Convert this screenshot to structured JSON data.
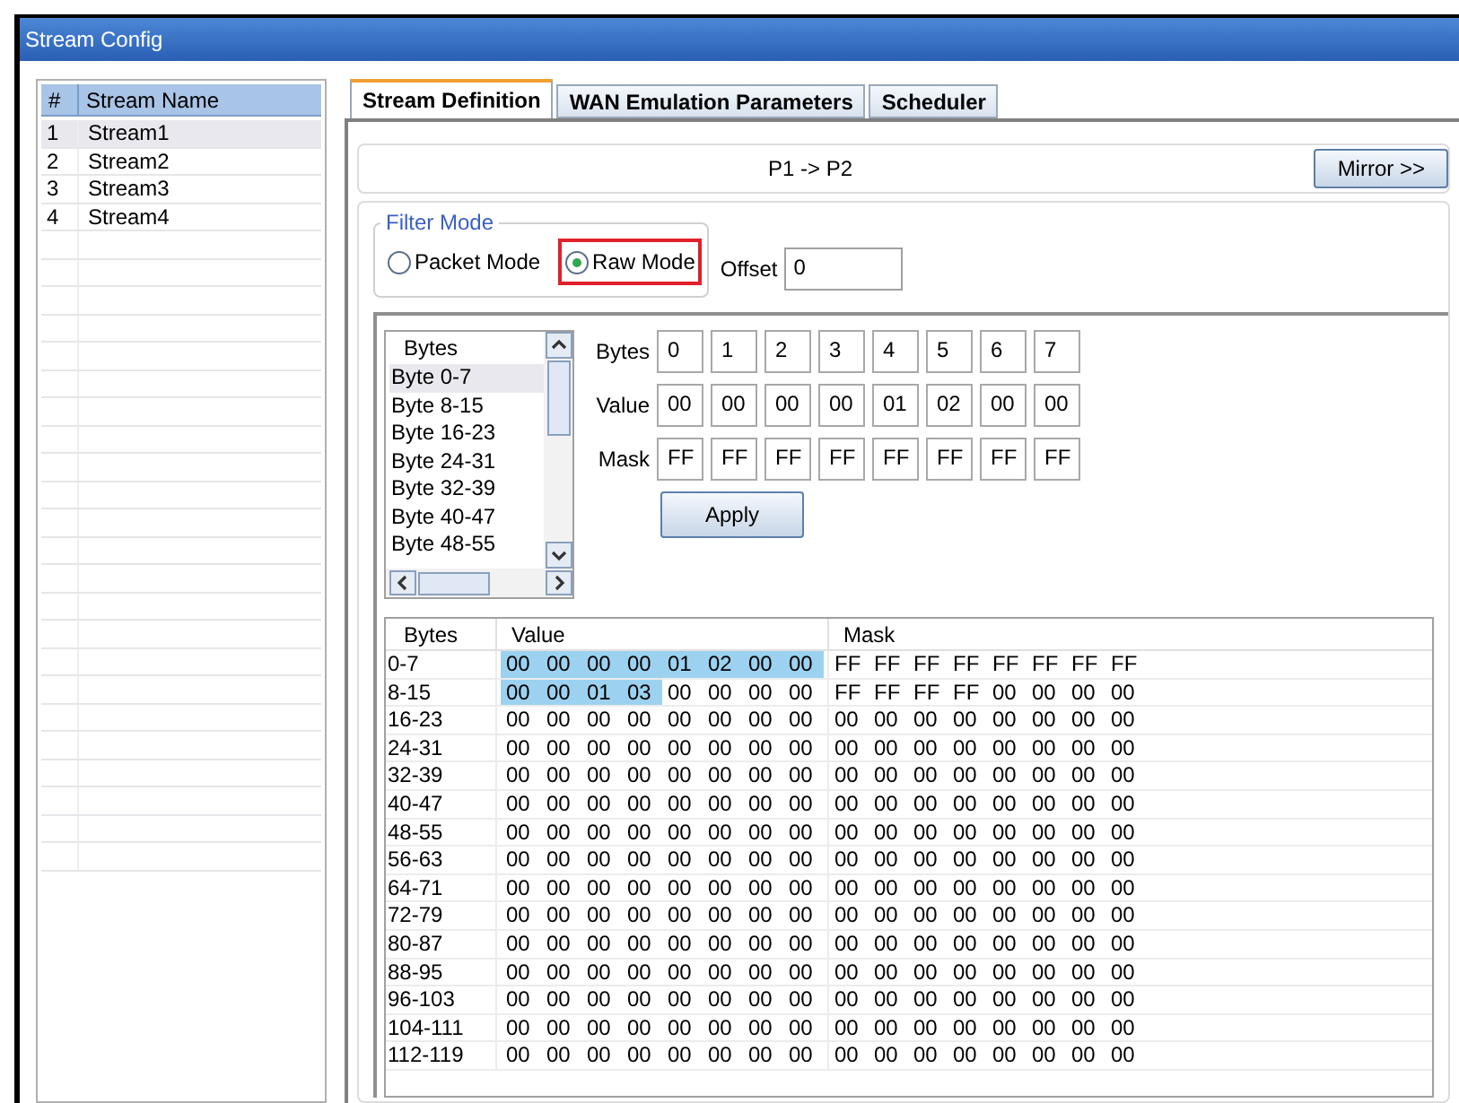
{
  "window": {
    "title": "Stream Config"
  },
  "streams": {
    "columns": [
      "#",
      "Stream Name"
    ],
    "rows": [
      {
        "num": "1",
        "name": "Stream1",
        "selected": true
      },
      {
        "num": "2",
        "name": "Stream2",
        "selected": false
      },
      {
        "num": "3",
        "name": "Stream3",
        "selected": false
      },
      {
        "num": "4",
        "name": "Stream4",
        "selected": false
      }
    ]
  },
  "tabs": [
    {
      "label": "Stream Definition",
      "selected": true
    },
    {
      "label": "WAN Emulation Parameters",
      "selected": false
    },
    {
      "label": "Scheduler",
      "selected": false
    }
  ],
  "direction": "P1 -> P2",
  "mirror_button": "Mirror >>",
  "filter_mode": {
    "legend": "Filter Mode",
    "options": [
      {
        "label": "Packet Mode",
        "selected": false
      },
      {
        "label": "Raw Mode",
        "selected": true
      }
    ]
  },
  "offset": {
    "label": "Offset",
    "value": "0"
  },
  "byte_list": {
    "header": "Bytes",
    "items": [
      {
        "label": "Byte 0-7",
        "selected": true
      },
      {
        "label": "Byte 8-15",
        "selected": false
      },
      {
        "label": "Byte 16-23",
        "selected": false
      },
      {
        "label": "Byte 24-31",
        "selected": false
      },
      {
        "label": "Byte 32-39",
        "selected": false
      },
      {
        "label": "Byte 40-47",
        "selected": false
      },
      {
        "label": "Byte 48-55",
        "selected": false
      }
    ]
  },
  "editor": {
    "bytes_label": "Bytes",
    "bytes": [
      "0",
      "1",
      "2",
      "3",
      "4",
      "5",
      "6",
      "7"
    ],
    "value_label": "Value",
    "values": [
      "00",
      "00",
      "00",
      "00",
      "01",
      "02",
      "00",
      "00"
    ],
    "mask_label": "Mask",
    "masks": [
      "FF",
      "FF",
      "FF",
      "FF",
      "FF",
      "FF",
      "FF",
      "FF"
    ],
    "apply_button": "Apply"
  },
  "table": {
    "columns": [
      "Bytes",
      "Value",
      "Mask"
    ],
    "rows": [
      {
        "bytes": "0-7",
        "values": [
          {
            "v": "00",
            "selected": true
          },
          {
            "v": "00",
            "selected": true
          },
          {
            "v": "00",
            "selected": true
          },
          {
            "v": "00",
            "selected": true
          },
          {
            "v": "01",
            "selected": true
          },
          {
            "v": "02",
            "selected": true
          },
          {
            "v": "00",
            "selected": true
          },
          {
            "v": "00",
            "selected": true
          }
        ],
        "masks": [
          "FF",
          "FF",
          "FF",
          "FF",
          "FF",
          "FF",
          "FF",
          "FF"
        ]
      },
      {
        "bytes": "8-15",
        "values": [
          {
            "v": "00",
            "selected": true
          },
          {
            "v": "00",
            "selected": true
          },
          {
            "v": "01",
            "selected": true
          },
          {
            "v": "03",
            "selected": true
          },
          {
            "v": "00",
            "selected": false
          },
          {
            "v": "00",
            "selected": false
          },
          {
            "v": "00",
            "selected": false
          },
          {
            "v": "00",
            "selected": false
          }
        ],
        "masks": [
          "FF",
          "FF",
          "FF",
          "FF",
          "00",
          "00",
          "00",
          "00"
        ]
      },
      {
        "bytes": "16-23",
        "values": [
          {
            "v": "00",
            "selected": false
          },
          {
            "v": "00",
            "selected": false
          },
          {
            "v": "00",
            "selected": false
          },
          {
            "v": "00",
            "selected": false
          },
          {
            "v": "00",
            "selected": false
          },
          {
            "v": "00",
            "selected": false
          },
          {
            "v": "00",
            "selected": false
          },
          {
            "v": "00",
            "selected": false
          }
        ],
        "masks": [
          "00",
          "00",
          "00",
          "00",
          "00",
          "00",
          "00",
          "00"
        ]
      },
      {
        "bytes": "24-31",
        "values": [
          {
            "v": "00",
            "selected": false
          },
          {
            "v": "00",
            "selected": false
          },
          {
            "v": "00",
            "selected": false
          },
          {
            "v": "00",
            "selected": false
          },
          {
            "v": "00",
            "selected": false
          },
          {
            "v": "00",
            "selected": false
          },
          {
            "v": "00",
            "selected": false
          },
          {
            "v": "00",
            "selected": false
          }
        ],
        "masks": [
          "00",
          "00",
          "00",
          "00",
          "00",
          "00",
          "00",
          "00"
        ]
      },
      {
        "bytes": "32-39",
        "values": [
          {
            "v": "00",
            "selected": false
          },
          {
            "v": "00",
            "selected": false
          },
          {
            "v": "00",
            "selected": false
          },
          {
            "v": "00",
            "selected": false
          },
          {
            "v": "00",
            "selected": false
          },
          {
            "v": "00",
            "selected": false
          },
          {
            "v": "00",
            "selected": false
          },
          {
            "v": "00",
            "selected": false
          }
        ],
        "masks": [
          "00",
          "00",
          "00",
          "00",
          "00",
          "00",
          "00",
          "00"
        ]
      },
      {
        "bytes": "40-47",
        "values": [
          {
            "v": "00",
            "selected": false
          },
          {
            "v": "00",
            "selected": false
          },
          {
            "v": "00",
            "selected": false
          },
          {
            "v": "00",
            "selected": false
          },
          {
            "v": "00",
            "selected": false
          },
          {
            "v": "00",
            "selected": false
          },
          {
            "v": "00",
            "selected": false
          },
          {
            "v": "00",
            "selected": false
          }
        ],
        "masks": [
          "00",
          "00",
          "00",
          "00",
          "00",
          "00",
          "00",
          "00"
        ]
      },
      {
        "bytes": "48-55",
        "values": [
          {
            "v": "00",
            "selected": false
          },
          {
            "v": "00",
            "selected": false
          },
          {
            "v": "00",
            "selected": false
          },
          {
            "v": "00",
            "selected": false
          },
          {
            "v": "00",
            "selected": false
          },
          {
            "v": "00",
            "selected": false
          },
          {
            "v": "00",
            "selected": false
          },
          {
            "v": "00",
            "selected": false
          }
        ],
        "masks": [
          "00",
          "00",
          "00",
          "00",
          "00",
          "00",
          "00",
          "00"
        ]
      },
      {
        "bytes": "56-63",
        "values": [
          {
            "v": "00",
            "selected": false
          },
          {
            "v": "00",
            "selected": false
          },
          {
            "v": "00",
            "selected": false
          },
          {
            "v": "00",
            "selected": false
          },
          {
            "v": "00",
            "selected": false
          },
          {
            "v": "00",
            "selected": false
          },
          {
            "v": "00",
            "selected": false
          },
          {
            "v": "00",
            "selected": false
          }
        ],
        "masks": [
          "00",
          "00",
          "00",
          "00",
          "00",
          "00",
          "00",
          "00"
        ]
      },
      {
        "bytes": "64-71",
        "values": [
          {
            "v": "00",
            "selected": false
          },
          {
            "v": "00",
            "selected": false
          },
          {
            "v": "00",
            "selected": false
          },
          {
            "v": "00",
            "selected": false
          },
          {
            "v": "00",
            "selected": false
          },
          {
            "v": "00",
            "selected": false
          },
          {
            "v": "00",
            "selected": false
          },
          {
            "v": "00",
            "selected": false
          }
        ],
        "masks": [
          "00",
          "00",
          "00",
          "00",
          "00",
          "00",
          "00",
          "00"
        ]
      },
      {
        "bytes": "72-79",
        "values": [
          {
            "v": "00",
            "selected": false
          },
          {
            "v": "00",
            "selected": false
          },
          {
            "v": "00",
            "selected": false
          },
          {
            "v": "00",
            "selected": false
          },
          {
            "v": "00",
            "selected": false
          },
          {
            "v": "00",
            "selected": false
          },
          {
            "v": "00",
            "selected": false
          },
          {
            "v": "00",
            "selected": false
          }
        ],
        "masks": [
          "00",
          "00",
          "00",
          "00",
          "00",
          "00",
          "00",
          "00"
        ]
      },
      {
        "bytes": "80-87",
        "values": [
          {
            "v": "00",
            "selected": false
          },
          {
            "v": "00",
            "selected": false
          },
          {
            "v": "00",
            "selected": false
          },
          {
            "v": "00",
            "selected": false
          },
          {
            "v": "00",
            "selected": false
          },
          {
            "v": "00",
            "selected": false
          },
          {
            "v": "00",
            "selected": false
          },
          {
            "v": "00",
            "selected": false
          }
        ],
        "masks": [
          "00",
          "00",
          "00",
          "00",
          "00",
          "00",
          "00",
          "00"
        ]
      },
      {
        "bytes": "88-95",
        "values": [
          {
            "v": "00",
            "selected": false
          },
          {
            "v": "00",
            "selected": false
          },
          {
            "v": "00",
            "selected": false
          },
          {
            "v": "00",
            "selected": false
          },
          {
            "v": "00",
            "selected": false
          },
          {
            "v": "00",
            "selected": false
          },
          {
            "v": "00",
            "selected": false
          },
          {
            "v": "00",
            "selected": false
          }
        ],
        "masks": [
          "00",
          "00",
          "00",
          "00",
          "00",
          "00",
          "00",
          "00"
        ]
      },
      {
        "bytes": "96-103",
        "values": [
          {
            "v": "00",
            "selected": false
          },
          {
            "v": "00",
            "selected": false
          },
          {
            "v": "00",
            "selected": false
          },
          {
            "v": "00",
            "selected": false
          },
          {
            "v": "00",
            "selected": false
          },
          {
            "v": "00",
            "selected": false
          },
          {
            "v": "00",
            "selected": false
          },
          {
            "v": "00",
            "selected": false
          }
        ],
        "masks": [
          "00",
          "00",
          "00",
          "00",
          "00",
          "00",
          "00",
          "00"
        ]
      },
      {
        "bytes": "104-111",
        "values": [
          {
            "v": "00",
            "selected": false
          },
          {
            "v": "00",
            "selected": false
          },
          {
            "v": "00",
            "selected": false
          },
          {
            "v": "00",
            "selected": false
          },
          {
            "v": "00",
            "selected": false
          },
          {
            "v": "00",
            "selected": false
          },
          {
            "v": "00",
            "selected": false
          },
          {
            "v": "00",
            "selected": false
          }
        ],
        "masks": [
          "00",
          "00",
          "00",
          "00",
          "00",
          "00",
          "00",
          "00"
        ]
      },
      {
        "bytes": "112-119",
        "values": [
          {
            "v": "00",
            "selected": false
          },
          {
            "v": "00",
            "selected": false
          },
          {
            "v": "00",
            "selected": false
          },
          {
            "v": "00",
            "selected": false
          },
          {
            "v": "00",
            "selected": false
          },
          {
            "v": "00",
            "selected": false
          },
          {
            "v": "00",
            "selected": false
          },
          {
            "v": "00",
            "selected": false
          }
        ],
        "masks": [
          "00",
          "00",
          "00",
          "00",
          "00",
          "00",
          "00",
          "00"
        ]
      }
    ]
  }
}
